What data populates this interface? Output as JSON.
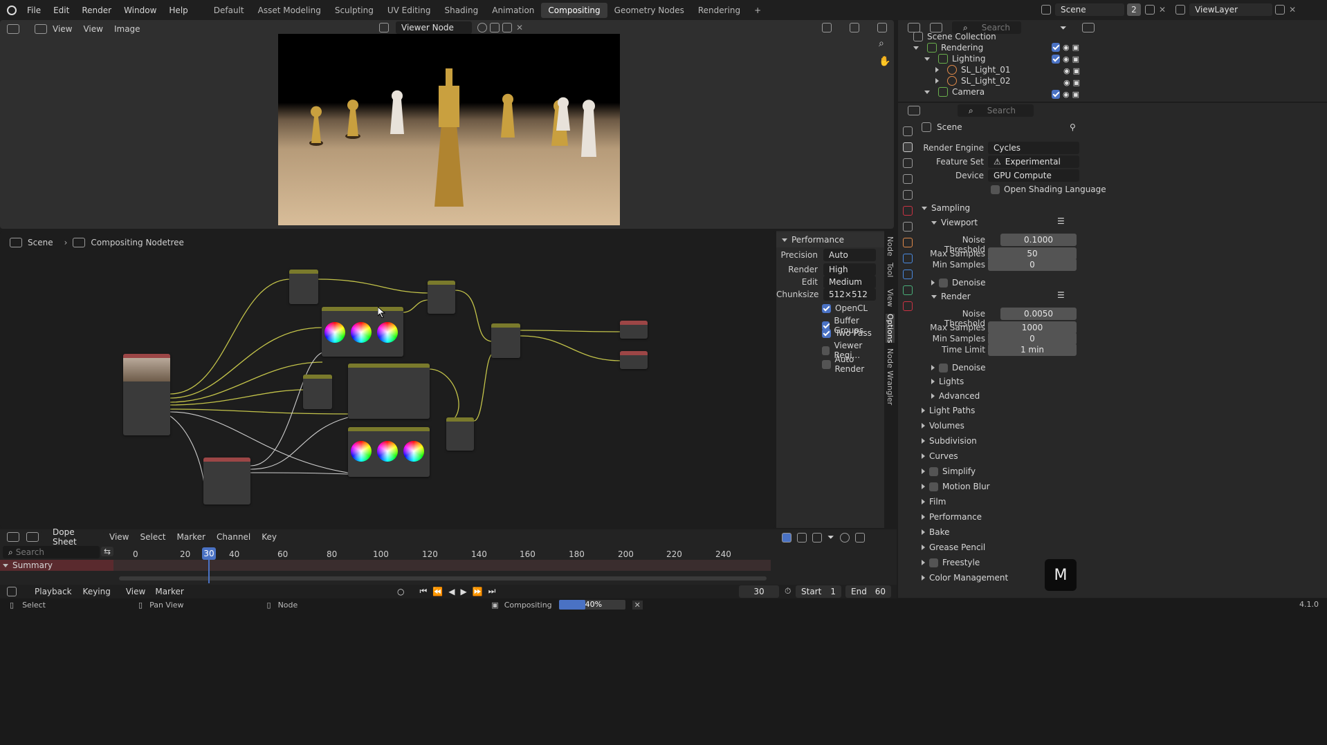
{
  "menubar": {
    "items": [
      "File",
      "Edit",
      "Render",
      "Window",
      "Help"
    ],
    "workspaces": [
      "Default",
      "Asset Modeling",
      "Sculpting",
      "UV Editing",
      "Shading",
      "Animation",
      "Compositing",
      "Geometry Nodes",
      "Rendering"
    ],
    "active_workspace": "Compositing",
    "scene": "Scene",
    "scene_users": "2",
    "view_layer": "ViewLayer"
  },
  "image_editor": {
    "menu": [
      "View",
      "View",
      "Image"
    ],
    "viewer_node": "Viewer Node"
  },
  "node_editor": {
    "breadcrumb": [
      "Scene",
      "Compositing Nodetree"
    ],
    "side_tabs": [
      "Node",
      "Tool",
      "View",
      "Options",
      "Node Wrangler"
    ]
  },
  "performance": {
    "title": "Performance",
    "precision_label": "Precision",
    "precision": "Auto",
    "render_label": "Render",
    "render": "High",
    "edit_label": "Edit",
    "edit": "Medium",
    "chunksize_label": "Chunksize",
    "chunksize": "512×512",
    "opencl": "OpenCL",
    "buffer_groups": "Buffer Groups",
    "two_pass": "Two Pass",
    "viewer_region": "Viewer Regi...",
    "auto_render": "Auto Render"
  },
  "outliner": {
    "search_placeholder": "Search",
    "items": [
      "Scene Collection",
      "Rendering",
      "Lighting",
      "SL_Light_01",
      "SL_Light_02",
      "Camera"
    ]
  },
  "properties": {
    "search_placeholder": "Search",
    "context": "Scene",
    "render_engine_label": "Render Engine",
    "render_engine": "Cycles",
    "feature_set_label": "Feature Set",
    "feature_set": "Experimental",
    "device_label": "Device",
    "device": "GPU Compute",
    "osl": "Open Shading Language",
    "sampling": "Sampling",
    "viewport": "Viewport",
    "noise_threshold_label": "Noise Threshold",
    "vp_noise": "0.1000",
    "max_samples_label": "Max Samples",
    "vp_max": "50",
    "min_samples_label": "Min Samples",
    "vp_min": "0",
    "denoise": "Denoise",
    "render": "Render",
    "r_noise": "0.0050",
    "r_max": "1000",
    "r_min": "0",
    "time_limit_label": "Time Limit",
    "r_time": "1 min",
    "lights": "Lights",
    "advanced": "Advanced",
    "sections": [
      "Light Paths",
      "Volumes",
      "Subdivision",
      "Curves",
      "Simplify",
      "Motion Blur",
      "Film",
      "Performance",
      "Bake",
      "Grease Pencil",
      "Freestyle",
      "Color Management"
    ]
  },
  "dopesheet": {
    "mode": "Dope Sheet",
    "menu": [
      "View",
      "Select",
      "Marker",
      "Channel",
      "Key"
    ],
    "search_placeholder": "Search",
    "summary": "Summary",
    "ticks": [
      "0",
      "20",
      "40",
      "60",
      "80",
      "100",
      "120",
      "140",
      "160",
      "180",
      "200",
      "220",
      "240"
    ],
    "current_frame": "30"
  },
  "playback": {
    "menu": [
      "Playback",
      "Keying",
      "View",
      "Marker"
    ],
    "frame": "30",
    "start_label": "Start",
    "start": "1",
    "end_label": "End",
    "end": "60"
  },
  "statusbar": {
    "select": "Select",
    "pan": "Pan View",
    "node": "Node",
    "job": "Compositing",
    "progress": "40%",
    "progress_value": 0.4,
    "version": "4.1.0",
    "badge": "M"
  }
}
